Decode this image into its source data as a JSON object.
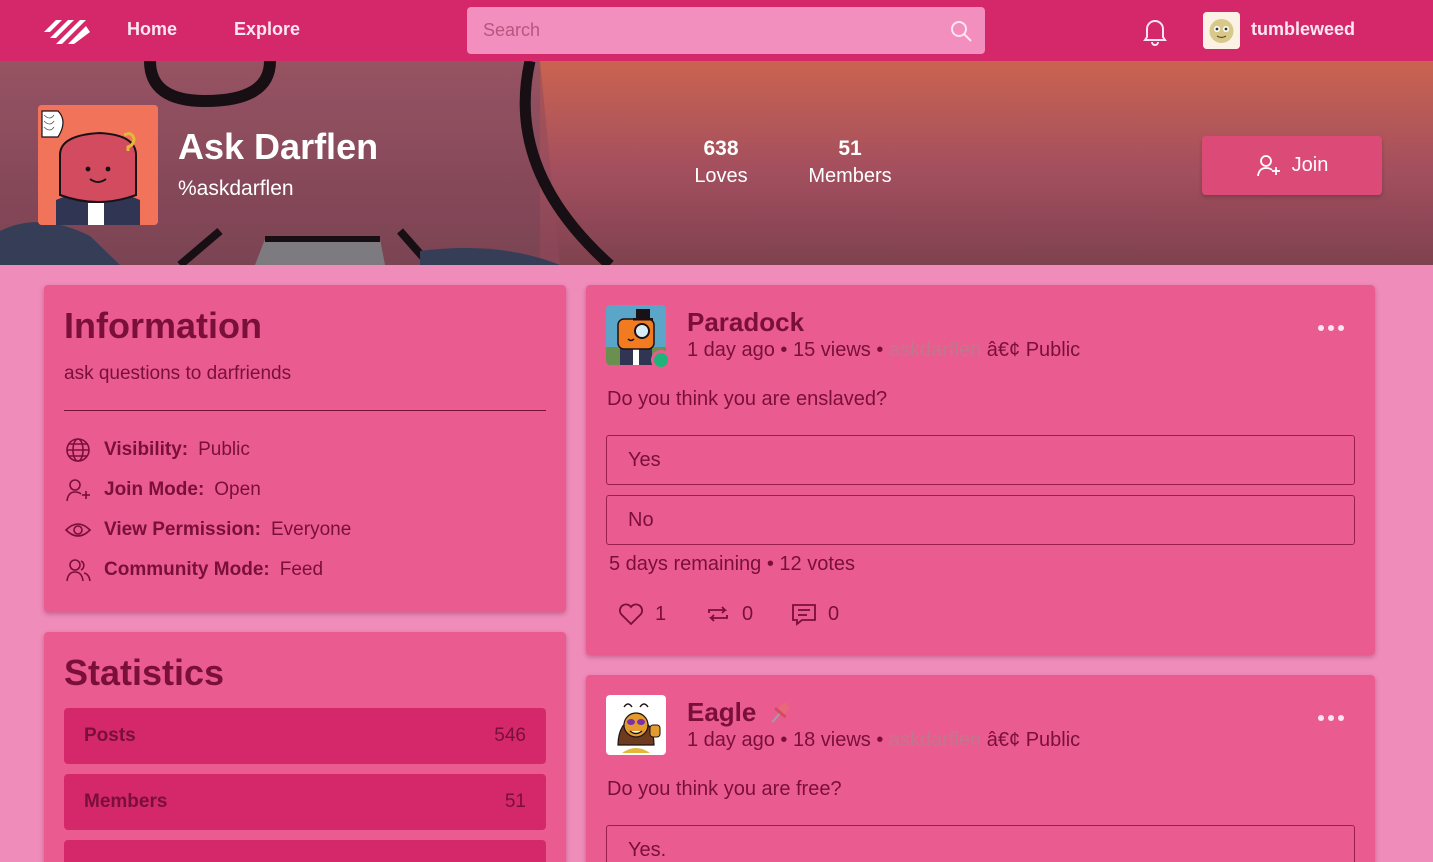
{
  "nav": {
    "home": "Home",
    "explore": "Explore",
    "search_placeholder": "Search",
    "username": "tumbleweed"
  },
  "community": {
    "name": "Ask Darflen",
    "handle": "%askdarflen",
    "loves_count": "638",
    "loves_label": "Loves",
    "members_count": "51",
    "members_label": "Members",
    "join_label": "Join"
  },
  "information": {
    "title": "Information",
    "description": "ask questions to darfriends",
    "rows": [
      {
        "label": "Visibility:",
        "value": "Public",
        "icon": "globe-icon"
      },
      {
        "label": "Join Mode:",
        "value": "Open",
        "icon": "user-plus-icon"
      },
      {
        "label": "View Permission:",
        "value": "Everyone",
        "icon": "eye-icon"
      },
      {
        "label": "Community Mode:",
        "value": "Feed",
        "icon": "users-icon"
      }
    ]
  },
  "statistics": {
    "title": "Statistics",
    "rows": [
      {
        "label": "Posts",
        "value": "546"
      },
      {
        "label": "Members",
        "value": "51"
      }
    ]
  },
  "posts": [
    {
      "author": "Paradock",
      "time": "1 day ago",
      "views": "15 views",
      "community": "askdarflen",
      "separator": "â€¢",
      "visibility": "Public",
      "question": "Do you think you are enslaved?",
      "options": [
        "Yes",
        "No"
      ],
      "poll_info": "5 days remaining • 12 votes",
      "likes": "1",
      "reposts": "0",
      "comments": "0",
      "online": true
    },
    {
      "author": "Eagle",
      "pinned_icon": "pin-icon",
      "time": "1 day ago",
      "views": "18 views",
      "community": "askdarflen",
      "separator": "â€¢",
      "visibility": "Public",
      "question": "Do you think you are free?",
      "options": [
        "Yes."
      ]
    }
  ],
  "colors": {
    "topbar": "#d4286a",
    "page_bg": "#f08cba",
    "card_bg": "#ea5c90",
    "text": "#7a0f3a",
    "online": "#1fb37a"
  }
}
